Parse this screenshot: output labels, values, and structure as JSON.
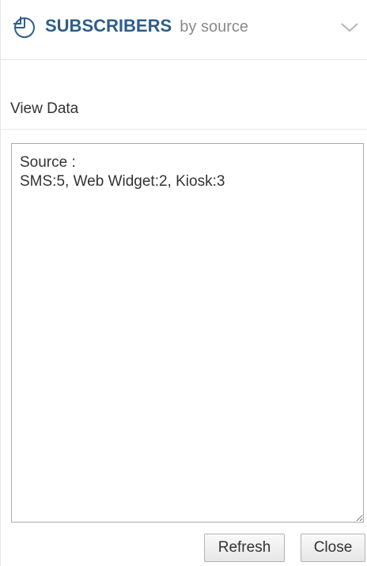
{
  "header": {
    "icon": "pie-chart-icon",
    "title": "SUBSCRIBERS",
    "subtitle": "by source",
    "toggle_icon": "chevron-down-icon"
  },
  "view_data": {
    "label": "View Data"
  },
  "data_box": {
    "value": "Source :\nSMS:5, Web Widget:2, Kiosk:3"
  },
  "footer": {
    "refresh_label": "Refresh",
    "close_label": "Close"
  },
  "colors": {
    "title": "#2f5d8a",
    "subtitle": "#8a8a8a",
    "text": "#333333",
    "divider": "#e8e8e8"
  }
}
